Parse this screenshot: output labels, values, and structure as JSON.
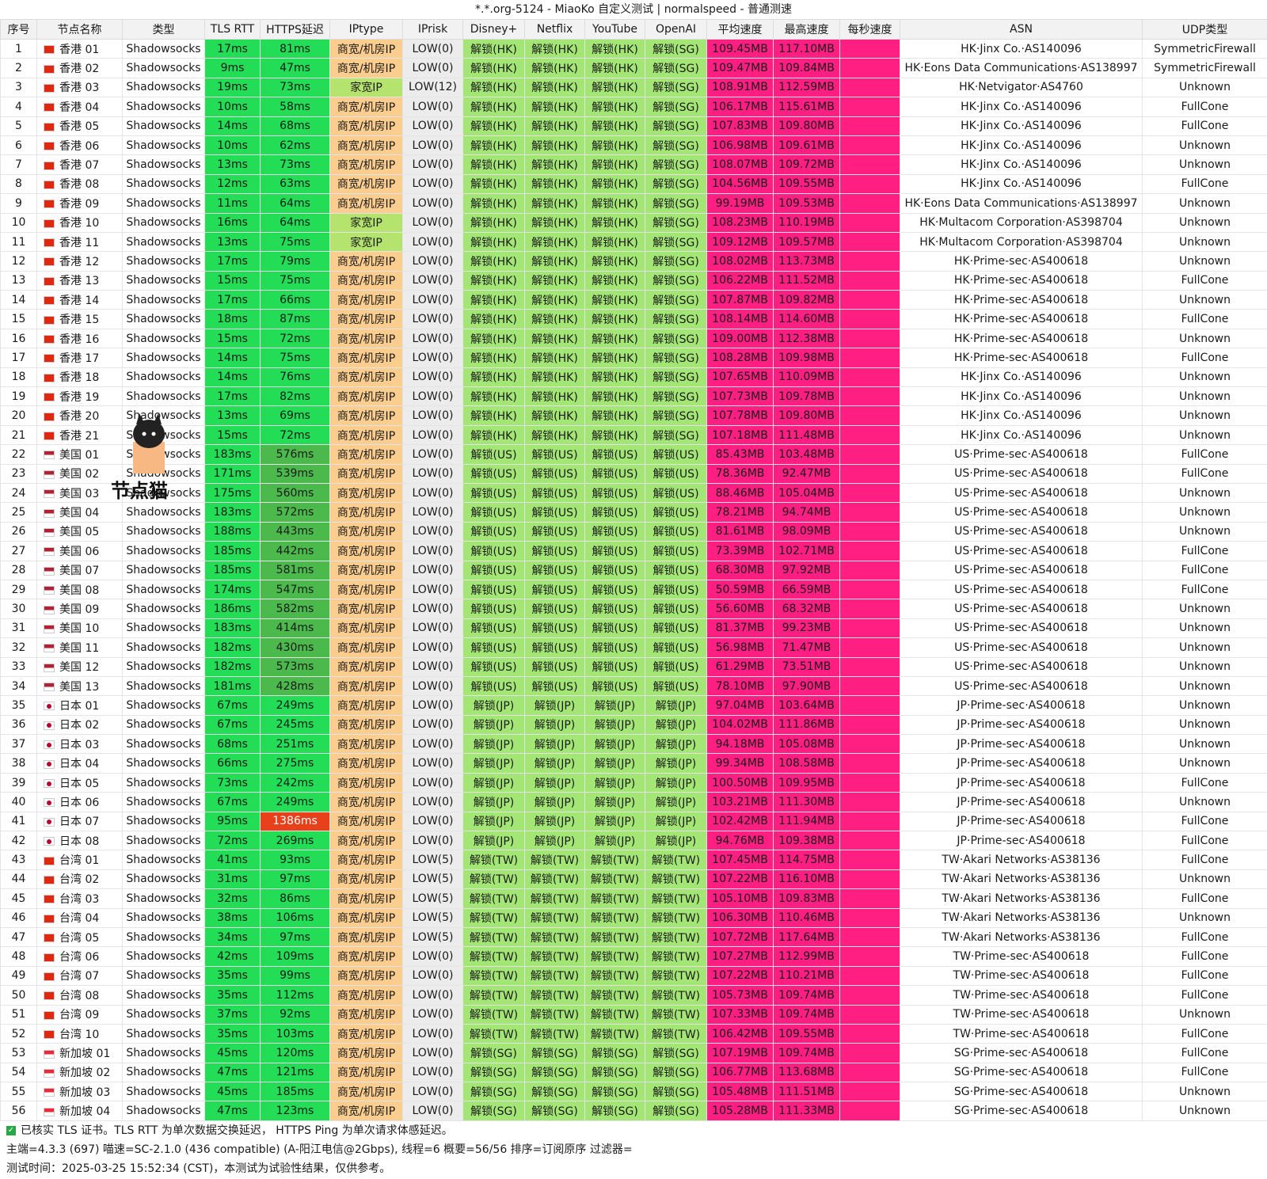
{
  "title": "*.*.org-5124 - MiaoKo 自定义测试 | normalspeed - 普通测速",
  "headers": [
    "序号",
    "节点名称",
    "类型",
    "TLS RTT",
    "HTTPS延迟",
    "IPtype",
    "IPrisk",
    "Disney+",
    "Netflix",
    "YouTube",
    "OpenAI",
    "平均速度",
    "最高速度",
    "每秒速度",
    "ASN",
    "UDP类型"
  ],
  "rows": [
    [
      "1",
      "hk",
      "香港 01",
      "Shadowsocks",
      "17ms",
      "81ms",
      "商宽/机房IP",
      "LOW(0)",
      "解锁(HK)",
      "解锁(HK)",
      "解锁(HK)",
      "解锁(SG)",
      "109.45MB",
      "117.10MB",
      "HK·Jinx Co.·AS140096",
      "SymmetricFirewall"
    ],
    [
      "2",
      "hk",
      "香港 02",
      "Shadowsocks",
      "9ms",
      "47ms",
      "商宽/机房IP",
      "LOW(0)",
      "解锁(HK)",
      "解锁(HK)",
      "解锁(HK)",
      "解锁(SG)",
      "109.47MB",
      "109.84MB",
      "HK·Eons Data Communications·AS138997",
      "SymmetricFirewall"
    ],
    [
      "3",
      "hk",
      "香港 03",
      "Shadowsocks",
      "19ms",
      "73ms",
      "家宽IP",
      "LOW(12)",
      "解锁(HK)",
      "解锁(HK)",
      "解锁(HK)",
      "解锁(SG)",
      "108.91MB",
      "112.59MB",
      "HK·Netvigator·AS4760",
      "Unknown"
    ],
    [
      "4",
      "hk",
      "香港 04",
      "Shadowsocks",
      "10ms",
      "58ms",
      "商宽/机房IP",
      "LOW(0)",
      "解锁(HK)",
      "解锁(HK)",
      "解锁(HK)",
      "解锁(SG)",
      "106.17MB",
      "115.61MB",
      "HK·Jinx Co.·AS140096",
      "FullCone"
    ],
    [
      "5",
      "hk",
      "香港 05",
      "Shadowsocks",
      "14ms",
      "68ms",
      "商宽/机房IP",
      "LOW(0)",
      "解锁(HK)",
      "解锁(HK)",
      "解锁(HK)",
      "解锁(SG)",
      "107.83MB",
      "109.80MB",
      "HK·Jinx Co.·AS140096",
      "FullCone"
    ],
    [
      "6",
      "hk",
      "香港 06",
      "Shadowsocks",
      "10ms",
      "62ms",
      "商宽/机房IP",
      "LOW(0)",
      "解锁(HK)",
      "解锁(HK)",
      "解锁(HK)",
      "解锁(SG)",
      "106.98MB",
      "109.61MB",
      "HK·Jinx Co.·AS140096",
      "Unknown"
    ],
    [
      "7",
      "hk",
      "香港 07",
      "Shadowsocks",
      "13ms",
      "73ms",
      "商宽/机房IP",
      "LOW(0)",
      "解锁(HK)",
      "解锁(HK)",
      "解锁(HK)",
      "解锁(SG)",
      "108.07MB",
      "109.72MB",
      "HK·Jinx Co.·AS140096",
      "Unknown"
    ],
    [
      "8",
      "hk",
      "香港 08",
      "Shadowsocks",
      "12ms",
      "63ms",
      "商宽/机房IP",
      "LOW(0)",
      "解锁(HK)",
      "解锁(HK)",
      "解锁(HK)",
      "解锁(SG)",
      "104.56MB",
      "109.55MB",
      "HK·Jinx Co.·AS140096",
      "FullCone"
    ],
    [
      "9",
      "hk",
      "香港 09",
      "Shadowsocks",
      "11ms",
      "64ms",
      "商宽/机房IP",
      "LOW(0)",
      "解锁(HK)",
      "解锁(HK)",
      "解锁(HK)",
      "解锁(SG)",
      "99.19MB",
      "109.53MB",
      "HK·Eons Data Communications·AS138997",
      "Unknown"
    ],
    [
      "10",
      "hk",
      "香港 10",
      "Shadowsocks",
      "16ms",
      "64ms",
      "家宽IP",
      "LOW(0)",
      "解锁(HK)",
      "解锁(HK)",
      "解锁(HK)",
      "解锁(SG)",
      "108.23MB",
      "110.19MB",
      "HK·Multacom Corporation·AS398704",
      "Unknown"
    ],
    [
      "11",
      "hk",
      "香港 11",
      "Shadowsocks",
      "13ms",
      "75ms",
      "家宽IP",
      "LOW(0)",
      "解锁(HK)",
      "解锁(HK)",
      "解锁(HK)",
      "解锁(SG)",
      "109.12MB",
      "109.57MB",
      "HK·Multacom Corporation·AS398704",
      "Unknown"
    ],
    [
      "12",
      "hk",
      "香港 12",
      "Shadowsocks",
      "17ms",
      "79ms",
      "商宽/机房IP",
      "LOW(0)",
      "解锁(HK)",
      "解锁(HK)",
      "解锁(HK)",
      "解锁(SG)",
      "108.02MB",
      "113.73MB",
      "HK·Prime-sec·AS400618",
      "Unknown"
    ],
    [
      "13",
      "hk",
      "香港 13",
      "Shadowsocks",
      "15ms",
      "75ms",
      "商宽/机房IP",
      "LOW(0)",
      "解锁(HK)",
      "解锁(HK)",
      "解锁(HK)",
      "解锁(SG)",
      "106.22MB",
      "111.52MB",
      "HK·Prime-sec·AS400618",
      "FullCone"
    ],
    [
      "14",
      "hk",
      "香港 14",
      "Shadowsocks",
      "17ms",
      "66ms",
      "商宽/机房IP",
      "LOW(0)",
      "解锁(HK)",
      "解锁(HK)",
      "解锁(HK)",
      "解锁(SG)",
      "107.87MB",
      "109.82MB",
      "HK·Prime-sec·AS400618",
      "Unknown"
    ],
    [
      "15",
      "hk",
      "香港 15",
      "Shadowsocks",
      "18ms",
      "87ms",
      "商宽/机房IP",
      "LOW(0)",
      "解锁(HK)",
      "解锁(HK)",
      "解锁(HK)",
      "解锁(SG)",
      "108.14MB",
      "114.60MB",
      "HK·Prime-sec·AS400618",
      "FullCone"
    ],
    [
      "16",
      "hk",
      "香港 16",
      "Shadowsocks",
      "15ms",
      "72ms",
      "商宽/机房IP",
      "LOW(0)",
      "解锁(HK)",
      "解锁(HK)",
      "解锁(HK)",
      "解锁(SG)",
      "109.00MB",
      "112.38MB",
      "HK·Prime-sec·AS400618",
      "Unknown"
    ],
    [
      "17",
      "hk",
      "香港 17",
      "Shadowsocks",
      "14ms",
      "75ms",
      "商宽/机房IP",
      "LOW(0)",
      "解锁(HK)",
      "解锁(HK)",
      "解锁(HK)",
      "解锁(SG)",
      "108.28MB",
      "109.98MB",
      "HK·Prime-sec·AS400618",
      "FullCone"
    ],
    [
      "18",
      "hk",
      "香港 18",
      "Shadowsocks",
      "14ms",
      "76ms",
      "商宽/机房IP",
      "LOW(0)",
      "解锁(HK)",
      "解锁(HK)",
      "解锁(HK)",
      "解锁(SG)",
      "107.65MB",
      "110.09MB",
      "HK·Jinx Co.·AS140096",
      "Unknown"
    ],
    [
      "19",
      "hk",
      "香港 19",
      "Shadowsocks",
      "17ms",
      "82ms",
      "商宽/机房IP",
      "LOW(0)",
      "解锁(HK)",
      "解锁(HK)",
      "解锁(HK)",
      "解锁(SG)",
      "107.73MB",
      "109.78MB",
      "HK·Jinx Co.·AS140096",
      "Unknown"
    ],
    [
      "20",
      "hk",
      "香港 20",
      "Shadowsocks",
      "13ms",
      "69ms",
      "商宽/机房IP",
      "LOW(0)",
      "解锁(HK)",
      "解锁(HK)",
      "解锁(HK)",
      "解锁(SG)",
      "107.78MB",
      "109.80MB",
      "HK·Jinx Co.·AS140096",
      "Unknown"
    ],
    [
      "21",
      "hk",
      "香港 21",
      "Shadowsocks",
      "15ms",
      "72ms",
      "商宽/机房IP",
      "LOW(0)",
      "解锁(HK)",
      "解锁(HK)",
      "解锁(HK)",
      "解锁(SG)",
      "107.18MB",
      "111.48MB",
      "HK·Jinx Co.·AS140096",
      "Unknown"
    ],
    [
      "22",
      "us",
      "美国 01",
      "Shadowsocks",
      "183ms",
      "576ms",
      "商宽/机房IP",
      "LOW(0)",
      "解锁(US)",
      "解锁(US)",
      "解锁(US)",
      "解锁(US)",
      "85.43MB",
      "103.48MB",
      "US·Prime-sec·AS400618",
      "FullCone"
    ],
    [
      "23",
      "us",
      "美国 02",
      "Shadowsocks",
      "171ms",
      "539ms",
      "商宽/机房IP",
      "LOW(0)",
      "解锁(US)",
      "解锁(US)",
      "解锁(US)",
      "解锁(US)",
      "78.36MB",
      "92.47MB",
      "US·Prime-sec·AS400618",
      "FullCone"
    ],
    [
      "24",
      "us",
      "美国 03",
      "Shadowsocks",
      "175ms",
      "560ms",
      "商宽/机房IP",
      "LOW(0)",
      "解锁(US)",
      "解锁(US)",
      "解锁(US)",
      "解锁(US)",
      "88.46MB",
      "105.04MB",
      "US·Prime-sec·AS400618",
      "Unknown"
    ],
    [
      "25",
      "us",
      "美国 04",
      "Shadowsocks",
      "183ms",
      "572ms",
      "商宽/机房IP",
      "LOW(0)",
      "解锁(US)",
      "解锁(US)",
      "解锁(US)",
      "解锁(US)",
      "78.21MB",
      "94.74MB",
      "US·Prime-sec·AS400618",
      "Unknown"
    ],
    [
      "26",
      "us",
      "美国 05",
      "Shadowsocks",
      "188ms",
      "443ms",
      "商宽/机房IP",
      "LOW(0)",
      "解锁(US)",
      "解锁(US)",
      "解锁(US)",
      "解锁(US)",
      "81.61MB",
      "98.09MB",
      "US·Prime-sec·AS400618",
      "Unknown"
    ],
    [
      "27",
      "us",
      "美国 06",
      "Shadowsocks",
      "185ms",
      "442ms",
      "商宽/机房IP",
      "LOW(0)",
      "解锁(US)",
      "解锁(US)",
      "解锁(US)",
      "解锁(US)",
      "73.39MB",
      "102.71MB",
      "US·Prime-sec·AS400618",
      "FullCone"
    ],
    [
      "28",
      "us",
      "美国 07",
      "Shadowsocks",
      "185ms",
      "581ms",
      "商宽/机房IP",
      "LOW(0)",
      "解锁(US)",
      "解锁(US)",
      "解锁(US)",
      "解锁(US)",
      "68.30MB",
      "97.92MB",
      "US·Prime-sec·AS400618",
      "FullCone"
    ],
    [
      "29",
      "us",
      "美国 08",
      "Shadowsocks",
      "174ms",
      "547ms",
      "商宽/机房IP",
      "LOW(0)",
      "解锁(US)",
      "解锁(US)",
      "解锁(US)",
      "解锁(US)",
      "50.59MB",
      "66.59MB",
      "US·Prime-sec·AS400618",
      "FullCone"
    ],
    [
      "30",
      "us",
      "美国 09",
      "Shadowsocks",
      "186ms",
      "582ms",
      "商宽/机房IP",
      "LOW(0)",
      "解锁(US)",
      "解锁(US)",
      "解锁(US)",
      "解锁(US)",
      "56.60MB",
      "68.32MB",
      "US·Prime-sec·AS400618",
      "Unknown"
    ],
    [
      "31",
      "us",
      "美国 10",
      "Shadowsocks",
      "183ms",
      "414ms",
      "商宽/机房IP",
      "LOW(0)",
      "解锁(US)",
      "解锁(US)",
      "解锁(US)",
      "解锁(US)",
      "81.37MB",
      "99.23MB",
      "US·Prime-sec·AS400618",
      "Unknown"
    ],
    [
      "32",
      "us",
      "美国 11",
      "Shadowsocks",
      "182ms",
      "430ms",
      "商宽/机房IP",
      "LOW(0)",
      "解锁(US)",
      "解锁(US)",
      "解锁(US)",
      "解锁(US)",
      "56.98MB",
      "71.47MB",
      "US·Prime-sec·AS400618",
      "Unknown"
    ],
    [
      "33",
      "us",
      "美国 12",
      "Shadowsocks",
      "182ms",
      "573ms",
      "商宽/机房IP",
      "LOW(0)",
      "解锁(US)",
      "解锁(US)",
      "解锁(US)",
      "解锁(US)",
      "61.29MB",
      "73.51MB",
      "US·Prime-sec·AS400618",
      "Unknown"
    ],
    [
      "34",
      "us",
      "美国 13",
      "Shadowsocks",
      "181ms",
      "428ms",
      "商宽/机房IP",
      "LOW(0)",
      "解锁(US)",
      "解锁(US)",
      "解锁(US)",
      "解锁(US)",
      "78.10MB",
      "97.90MB",
      "US·Prime-sec·AS400618",
      "Unknown"
    ],
    [
      "35",
      "jp",
      "日本 01",
      "Shadowsocks",
      "67ms",
      "249ms",
      "商宽/机房IP",
      "LOW(0)",
      "解锁(JP)",
      "解锁(JP)",
      "解锁(JP)",
      "解锁(JP)",
      "97.04MB",
      "103.64MB",
      "JP·Prime-sec·AS400618",
      "Unknown"
    ],
    [
      "36",
      "jp",
      "日本 02",
      "Shadowsocks",
      "67ms",
      "245ms",
      "商宽/机房IP",
      "LOW(0)",
      "解锁(JP)",
      "解锁(JP)",
      "解锁(JP)",
      "解锁(JP)",
      "104.02MB",
      "111.86MB",
      "JP·Prime-sec·AS400618",
      "Unknown"
    ],
    [
      "37",
      "jp",
      "日本 03",
      "Shadowsocks",
      "68ms",
      "251ms",
      "商宽/机房IP",
      "LOW(0)",
      "解锁(JP)",
      "解锁(JP)",
      "解锁(JP)",
      "解锁(JP)",
      "94.18MB",
      "105.08MB",
      "JP·Prime-sec·AS400618",
      "Unknown"
    ],
    [
      "38",
      "jp",
      "日本 04",
      "Shadowsocks",
      "66ms",
      "275ms",
      "商宽/机房IP",
      "LOW(0)",
      "解锁(JP)",
      "解锁(JP)",
      "解锁(JP)",
      "解锁(JP)",
      "99.34MB",
      "108.58MB",
      "JP·Prime-sec·AS400618",
      "Unknown"
    ],
    [
      "39",
      "jp",
      "日本 05",
      "Shadowsocks",
      "73ms",
      "242ms",
      "商宽/机房IP",
      "LOW(0)",
      "解锁(JP)",
      "解锁(JP)",
      "解锁(JP)",
      "解锁(JP)",
      "100.50MB",
      "109.95MB",
      "JP·Prime-sec·AS400618",
      "FullCone"
    ],
    [
      "40",
      "jp",
      "日本 06",
      "Shadowsocks",
      "67ms",
      "249ms",
      "商宽/机房IP",
      "LOW(0)",
      "解锁(JP)",
      "解锁(JP)",
      "解锁(JP)",
      "解锁(JP)",
      "103.21MB",
      "111.30MB",
      "JP·Prime-sec·AS400618",
      "Unknown"
    ],
    [
      "41",
      "jp",
      "日本 07",
      "Shadowsocks",
      "95ms",
      "1386ms",
      "商宽/机房IP",
      "LOW(0)",
      "解锁(JP)",
      "解锁(JP)",
      "解锁(JP)",
      "解锁(JP)",
      "102.42MB",
      "111.94MB",
      "JP·Prime-sec·AS400618",
      "FullCone"
    ],
    [
      "42",
      "jp",
      "日本 08",
      "Shadowsocks",
      "72ms",
      "269ms",
      "商宽/机房IP",
      "LOW(0)",
      "解锁(JP)",
      "解锁(JP)",
      "解锁(JP)",
      "解锁(JP)",
      "94.76MB",
      "109.38MB",
      "JP·Prime-sec·AS400618",
      "FullCone"
    ],
    [
      "43",
      "tw",
      "台湾 01",
      "Shadowsocks",
      "41ms",
      "93ms",
      "商宽/机房IP",
      "LOW(5)",
      "解锁(TW)",
      "解锁(TW)",
      "解锁(TW)",
      "解锁(TW)",
      "107.45MB",
      "114.75MB",
      "TW·Akari Networks·AS38136",
      "FullCone"
    ],
    [
      "44",
      "tw",
      "台湾 02",
      "Shadowsocks",
      "31ms",
      "97ms",
      "商宽/机房IP",
      "LOW(5)",
      "解锁(TW)",
      "解锁(TW)",
      "解锁(TW)",
      "解锁(TW)",
      "107.22MB",
      "116.10MB",
      "TW·Akari Networks·AS38136",
      "Unknown"
    ],
    [
      "45",
      "tw",
      "台湾 03",
      "Shadowsocks",
      "32ms",
      "86ms",
      "商宽/机房IP",
      "LOW(5)",
      "解锁(TW)",
      "解锁(TW)",
      "解锁(TW)",
      "解锁(TW)",
      "105.10MB",
      "109.83MB",
      "TW·Akari Networks·AS38136",
      "FullCone"
    ],
    [
      "46",
      "tw",
      "台湾 04",
      "Shadowsocks",
      "38ms",
      "106ms",
      "商宽/机房IP",
      "LOW(5)",
      "解锁(TW)",
      "解锁(TW)",
      "解锁(TW)",
      "解锁(TW)",
      "106.30MB",
      "110.46MB",
      "TW·Akari Networks·AS38136",
      "Unknown"
    ],
    [
      "47",
      "tw",
      "台湾 05",
      "Shadowsocks",
      "34ms",
      "97ms",
      "商宽/机房IP",
      "LOW(5)",
      "解锁(TW)",
      "解锁(TW)",
      "解锁(TW)",
      "解锁(TW)",
      "107.72MB",
      "117.64MB",
      "TW·Akari Networks·AS38136",
      "FullCone"
    ],
    [
      "48",
      "tw",
      "台湾 06",
      "Shadowsocks",
      "42ms",
      "109ms",
      "商宽/机房IP",
      "LOW(0)",
      "解锁(TW)",
      "解锁(TW)",
      "解锁(TW)",
      "解锁(TW)",
      "107.27MB",
      "112.99MB",
      "TW·Prime-sec·AS400618",
      "FullCone"
    ],
    [
      "49",
      "tw",
      "台湾 07",
      "Shadowsocks",
      "35ms",
      "99ms",
      "商宽/机房IP",
      "LOW(0)",
      "解锁(TW)",
      "解锁(TW)",
      "解锁(TW)",
      "解锁(TW)",
      "107.22MB",
      "110.21MB",
      "TW·Prime-sec·AS400618",
      "FullCone"
    ],
    [
      "50",
      "tw",
      "台湾 08",
      "Shadowsocks",
      "35ms",
      "112ms",
      "商宽/机房IP",
      "LOW(0)",
      "解锁(TW)",
      "解锁(TW)",
      "解锁(TW)",
      "解锁(TW)",
      "105.73MB",
      "109.74MB",
      "TW·Prime-sec·AS400618",
      "FullCone"
    ],
    [
      "51",
      "tw",
      "台湾 09",
      "Shadowsocks",
      "37ms",
      "92ms",
      "商宽/机房IP",
      "LOW(0)",
      "解锁(TW)",
      "解锁(TW)",
      "解锁(TW)",
      "解锁(TW)",
      "107.33MB",
      "109.74MB",
      "TW·Prime-sec·AS400618",
      "Unknown"
    ],
    [
      "52",
      "tw",
      "台湾 10",
      "Shadowsocks",
      "35ms",
      "103ms",
      "商宽/机房IP",
      "LOW(0)",
      "解锁(TW)",
      "解锁(TW)",
      "解锁(TW)",
      "解锁(TW)",
      "106.42MB",
      "109.55MB",
      "TW·Prime-sec·AS400618",
      "FullCone"
    ],
    [
      "53",
      "sg",
      "新加坡 01",
      "Shadowsocks",
      "45ms",
      "120ms",
      "商宽/机房IP",
      "LOW(0)",
      "解锁(SG)",
      "解锁(SG)",
      "解锁(SG)",
      "解锁(SG)",
      "107.19MB",
      "109.74MB",
      "SG·Prime-sec·AS400618",
      "FullCone"
    ],
    [
      "54",
      "sg",
      "新加坡 02",
      "Shadowsocks",
      "47ms",
      "121ms",
      "商宽/机房IP",
      "LOW(0)",
      "解锁(SG)",
      "解锁(SG)",
      "解锁(SG)",
      "解锁(SG)",
      "106.77MB",
      "113.68MB",
      "SG·Prime-sec·AS400618",
      "FullCone"
    ],
    [
      "55",
      "sg",
      "新加坡 03",
      "Shadowsocks",
      "45ms",
      "185ms",
      "商宽/机房IP",
      "LOW(0)",
      "解锁(SG)",
      "解锁(SG)",
      "解锁(SG)",
      "解锁(SG)",
      "105.48MB",
      "111.51MB",
      "SG·Prime-sec·AS400618",
      "Unknown"
    ],
    [
      "56",
      "sg",
      "新加坡 04",
      "Shadowsocks",
      "47ms",
      "123ms",
      "商宽/机房IP",
      "LOW(0)",
      "解锁(SG)",
      "解锁(SG)",
      "解锁(SG)",
      "解锁(SG)",
      "105.28MB",
      "111.33MB",
      "SG·Prime-sec·AS400618",
      "Unknown"
    ]
  ],
  "footer": {
    "line1": "已核实 TLS 证书。TLS RTT 为单次数据交换延迟， HTTPS Ping 为单次请求体感延迟。",
    "line2": "主端=4.3.3 (697) 喵速=SC-2.1.0 (436 compatible) (A-阳江电信@2Gbps), 线程=6 概要=56/56 排序=订阅原序 过滤器=",
    "line3": "测试时间：2025-03-25 15:52:34 (CST)，本测试为试验性结果，仅供参考。"
  },
  "logo_text": "节点猫",
  "colors": {
    "rtt_green": "#22dd55",
    "https_green": "#22dd55",
    "https_dark": "#4cb94c",
    "https_red": "#e8401a",
    "iptype_commercial": "#fbcd8e",
    "iptype_home": "#b5e46e",
    "unlock": "#a3e676",
    "speed_pink": "#ff1f83"
  }
}
